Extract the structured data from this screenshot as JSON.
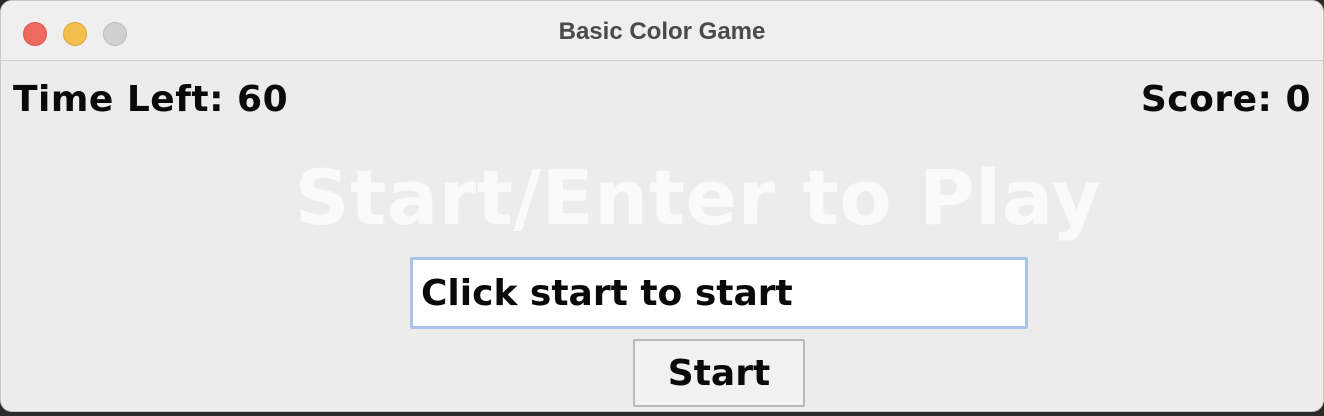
{
  "window": {
    "title": "Basic Color Game"
  },
  "hud": {
    "time_left": "Time Left: 60",
    "score": "Score: 0"
  },
  "game": {
    "prompt": "Start/Enter to Play",
    "prompt_color": "#fafafa"
  },
  "input": {
    "value": "Click start to start"
  },
  "controls": {
    "start_label": "Start"
  },
  "colors": {
    "window_bg": "#ececec",
    "close": "#ee6a5f",
    "minimize": "#f5bf4f",
    "zoom": "#d0d0d0",
    "input_focus_border": "#a9c4ea"
  }
}
